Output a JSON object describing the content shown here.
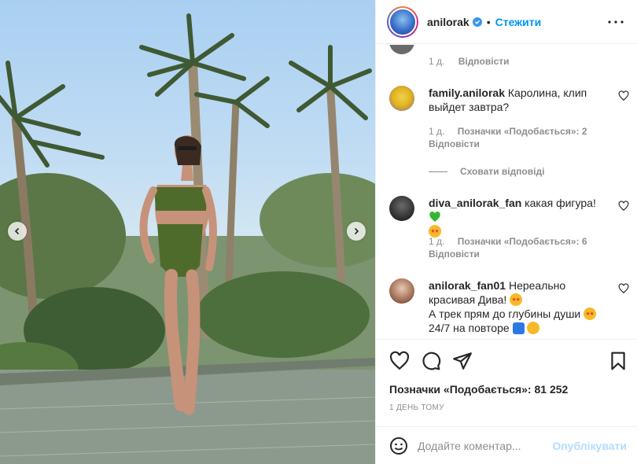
{
  "header": {
    "username": "anilorak",
    "separator": "•",
    "follow_label": "Стежити"
  },
  "top_partial_comment": {
    "time": "1 д.",
    "reply_label": "Відповісти"
  },
  "comments": [
    {
      "username": "family.anilorak",
      "text": "Каролина, клип выйдет завтра?",
      "time": "1 д.",
      "likes_label": "Позначки «Подобається»: 2",
      "reply_label": "Відповісти"
    },
    {
      "username": "diva_anilorak_fan",
      "text": "какая фигура!",
      "emojis": [
        "green-heart",
        "star-struck"
      ],
      "time": "1 д.",
      "likes_label": "Позначки «Подобається»: 6",
      "reply_label": "Відповісти"
    },
    {
      "username": "anilorak_fan01",
      "text_line1": "Нереально красивая Дива!",
      "text_line2": "А трек прям до глубины души",
      "text_line3": "24/7 на повторе"
    }
  ],
  "hide_replies_label": "Сховати відповіді",
  "actions": {
    "likes_text": "Позначки «Подобається»: 81 252",
    "date_text": "1 день тому"
  },
  "add_comment": {
    "placeholder": "Додайте коментар...",
    "publish_label": "Опублікувати"
  },
  "colors": {
    "accent": "#0095f6",
    "publish_disabled": "#b3dbff",
    "muted_text": "#8e8e8e",
    "text": "#262626",
    "bikini": "#4f6b2c"
  }
}
